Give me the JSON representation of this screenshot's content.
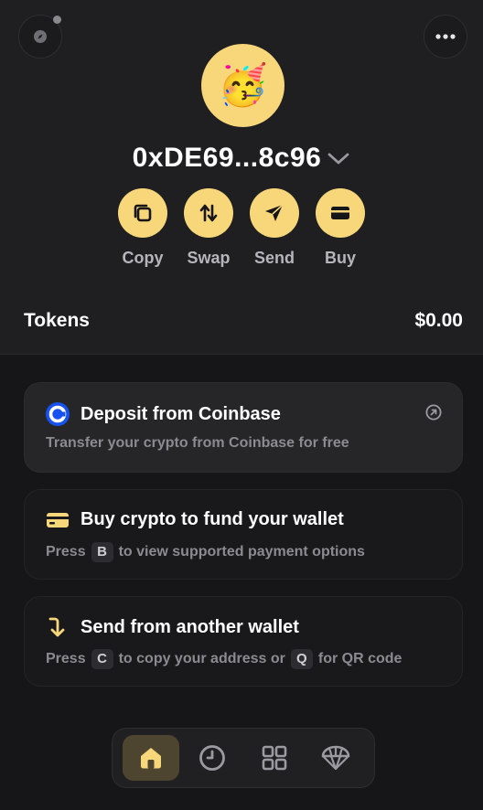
{
  "header": {
    "settings_icon": "compass-icon",
    "menu_icon": "more-dots-icon",
    "avatar_emoji": "🥳",
    "address": "0xDE69...8c96"
  },
  "actions": [
    {
      "label": "Copy",
      "icon": "copy-icon"
    },
    {
      "label": "Swap",
      "icon": "swap-icon"
    },
    {
      "label": "Send",
      "icon": "send-icon"
    },
    {
      "label": "Buy",
      "icon": "card-icon"
    }
  ],
  "tokens": {
    "label": "Tokens",
    "total": "$0.00"
  },
  "cards": {
    "deposit": {
      "title": "Deposit from Coinbase",
      "subtitle": "Transfer your crypto from Coinbase for free"
    },
    "buy": {
      "title": "Buy crypto to fund your wallet",
      "sub_before": "Press",
      "key": "B",
      "sub_after": "to view supported payment options"
    },
    "send": {
      "title": "Send from another wallet",
      "sub_before": "Press",
      "key1": "C",
      "sub_middle": "to copy your address or",
      "key2": "Q",
      "sub_after": "for QR code"
    }
  },
  "nav": {
    "items": [
      "home-icon",
      "clock-icon",
      "grid-icon",
      "parachute-icon"
    ],
    "active": "home-icon"
  },
  "colors": {
    "accent": "#f7d77a",
    "background": "#161618",
    "coinbase": "#1652f0"
  }
}
